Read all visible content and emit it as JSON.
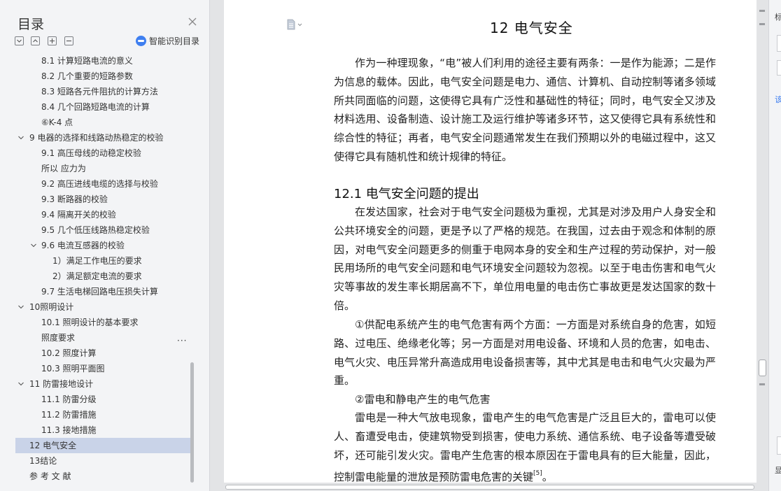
{
  "toc": {
    "title": "目录",
    "smart_button": "智能识别目录",
    "more": "···",
    "items": [
      {
        "label": "8.1 计算短路电流的意义",
        "indent": 2
      },
      {
        "label": "8.2 几个重要的短路参数",
        "indent": 2
      },
      {
        "label": "8.3 短路各元件阻抗的计算方法",
        "indent": 2
      },
      {
        "label": "8.4    几个回路短路电流的计算",
        "indent": 2
      },
      {
        "label": "⑥K-4 点",
        "indent": 2
      },
      {
        "label": "9    电器的选择和线路动热稳定的校验",
        "indent": 1,
        "expanded": true
      },
      {
        "label": "9.1 高压母线的动稳定校验",
        "indent": 2
      },
      {
        "label": "所以  应力为",
        "indent": 2
      },
      {
        "label": "9.2 高压进线电缆的选择与校验",
        "indent": 2
      },
      {
        "label": "9.3 断路器的校验",
        "indent": 2
      },
      {
        "label": "9.4 隔离开关的校验",
        "indent": 2
      },
      {
        "label": "9.5 几个低压线路热稳定校验",
        "indent": 2
      },
      {
        "label": "9.6 电流互感器的校验",
        "indent": 2,
        "expanded": true
      },
      {
        "label": "1）满足工作电压的要求",
        "indent": 3
      },
      {
        "label": "2）满足额定电流的要求",
        "indent": 3
      },
      {
        "label": "9.7 生活电梯回路电压损失计算",
        "indent": 2
      },
      {
        "label": "10照明设计",
        "indent": 1,
        "expanded": true
      },
      {
        "label": "10.1 照明设计的基本要求",
        "indent": 2
      },
      {
        "label": "照度要求",
        "indent": 2
      },
      {
        "label": "10.2 照度计算",
        "indent": 2
      },
      {
        "label": "10.3 照明平面图",
        "indent": 2
      },
      {
        "label": "11    防雷接地设计",
        "indent": 1,
        "expanded": true
      },
      {
        "label": "11.1 防雷分级",
        "indent": 2
      },
      {
        "label": "11.2 防雷措施",
        "indent": 2
      },
      {
        "label": "11.3 接地措施",
        "indent": 2
      },
      {
        "label": "12    电气安全",
        "indent": 1,
        "selected": true
      },
      {
        "label": "13结论",
        "indent": 1
      },
      {
        "label": "参 考 文 献",
        "indent": 1
      }
    ]
  },
  "document": {
    "chapter_title": "12    电气安全",
    "intro": "作为一种理现象，“电”被人们利用的途径主要有两条：一是作为能源；二是作为信息的载体。因此，电气安全问题是电力、通信、计算机、自动控制等诸多领域所共同面临的问题，这使得它具有广泛性和基础性的特征；同时，电气安全又涉及材料选用、设备制造、设计施工及运行维护等诸多环节，这又使得它具有系统性和综合性的特征；再者，电气安全问题通常发生在我们预期以外的电磁过程中，这又使得它具有随机性和统计规律的特征。",
    "section_heading": "12.1 电气安全问题的提出",
    "p1": "在发达国家，社会对于电气安全问题极为重视，尤其是对涉及用户人身安全和公共环境安全的问题，更是予以了严格的规范。在我国，过去由于观念和体制的原因，对电气安全问题更多的侧重于电网本身的安全和生产过程的劳动保护，对一般民用场所的电气安全问题和电气环境安全问题较为忽视。以至于电击伤害和电气火灾等事故的发生率长期居高不下，单位用电量的电击伤亡事故更是发达国家的数十倍。",
    "p2": "①供配电系统产生的电气危害有两个方面：一方面是对系统自身的危害，如短路、过电压、绝缘老化等；另一方面是对用电设备、环境和人员的危害，如电击、电气火灾、电压异常升高造成用电设备损害等，其中尤其是电击和电气火灾最为严重。",
    "p3": "②雷电和静电产生的电气危害",
    "p4": "雷电是一种大气放电现象，雷电产生的电气危害是广泛且巨大的，雷电可以使人、畜遭受电击，使建筑物受到损害，使电力系统、通信系统、电子设备等遭受破坏，还可能引发火灾。雷电产生危害的根本原因在于雷电具有的巨大能量，因此，控制雷电能量的泄放是预防雷电危害的关键",
    "p4_ref": "[5]",
    "p4_end": "。"
  },
  "side_panel": {
    "label_top": "标",
    "label_mid": "该",
    "label_bottom": "显"
  },
  "colors": {
    "accent": "#3f7ff0",
    "selected_bg": "#c9d3e8",
    "pane_bg": "#f3f4f6",
    "canvas_bg": "#e3e4e6"
  }
}
